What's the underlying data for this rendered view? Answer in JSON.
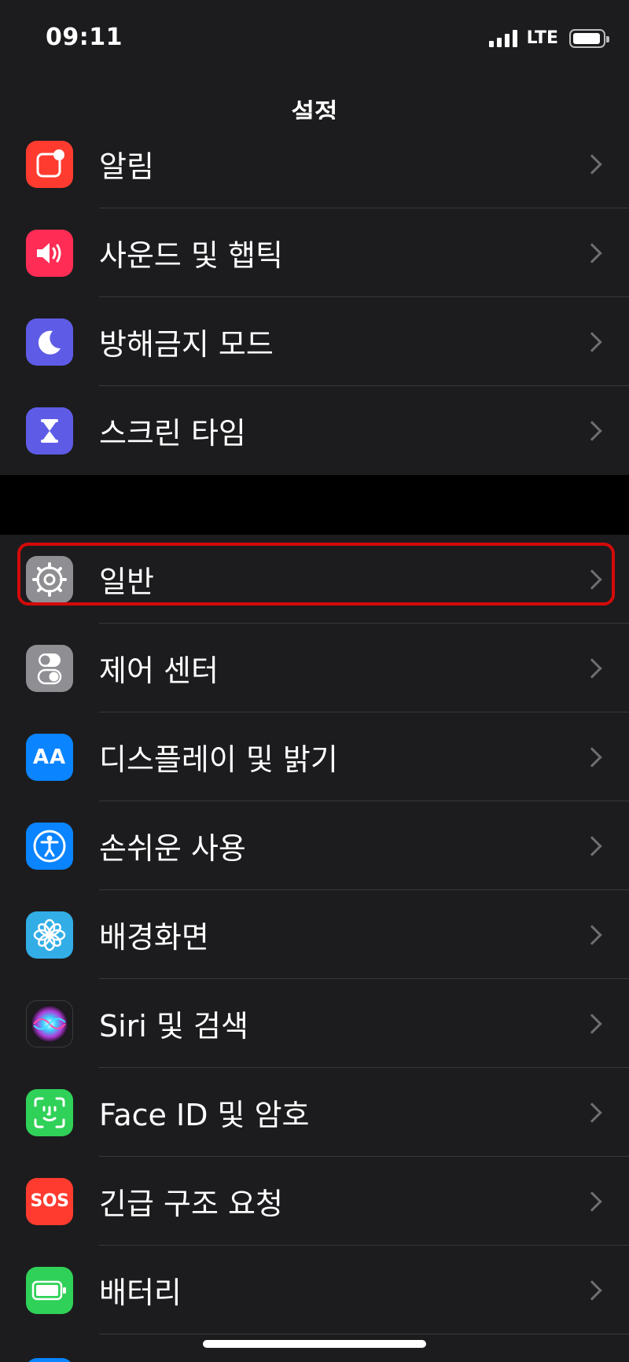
{
  "status": {
    "time": "09:11",
    "network": "LTE"
  },
  "nav": {
    "title": "설정"
  },
  "group1": [
    {
      "label": "알림",
      "icon": "notifications-icon",
      "color": "#ff3b30"
    },
    {
      "label": "사운드 및 햅틱",
      "icon": "sound-icon",
      "color": "#ff2d55"
    },
    {
      "label": "방해금지 모드",
      "icon": "moon-icon",
      "color": "#5e5ce6"
    },
    {
      "label": "스크린 타임",
      "icon": "hourglass-icon",
      "color": "#5e5ce6"
    }
  ],
  "group2": [
    {
      "label": "일반",
      "icon": "gear-icon",
      "color": "#8e8e93"
    },
    {
      "label": "제어 센터",
      "icon": "toggles-icon",
      "color": "#8e8e93"
    },
    {
      "label": "디스플레이 및 밝기",
      "icon": "display-aa-icon",
      "color": "#0a84ff",
      "glyph": "AA"
    },
    {
      "label": "손쉬운 사용",
      "icon": "accessibility-icon",
      "color": "#0a84ff"
    },
    {
      "label": "배경화면",
      "icon": "wallpaper-flower-icon",
      "color": "#32ade6"
    },
    {
      "label": "Siri 및 검색",
      "icon": "siri-icon",
      "color": "#1c1c1e"
    },
    {
      "label": "Face ID 및 암호",
      "icon": "face-id-icon",
      "color": "#30d158"
    },
    {
      "label": "긴급 구조 요청",
      "icon": "sos-icon",
      "color": "#ff3b30",
      "glyph": "SOS"
    },
    {
      "label": "배터리",
      "icon": "battery-icon",
      "color": "#30d158"
    }
  ]
}
